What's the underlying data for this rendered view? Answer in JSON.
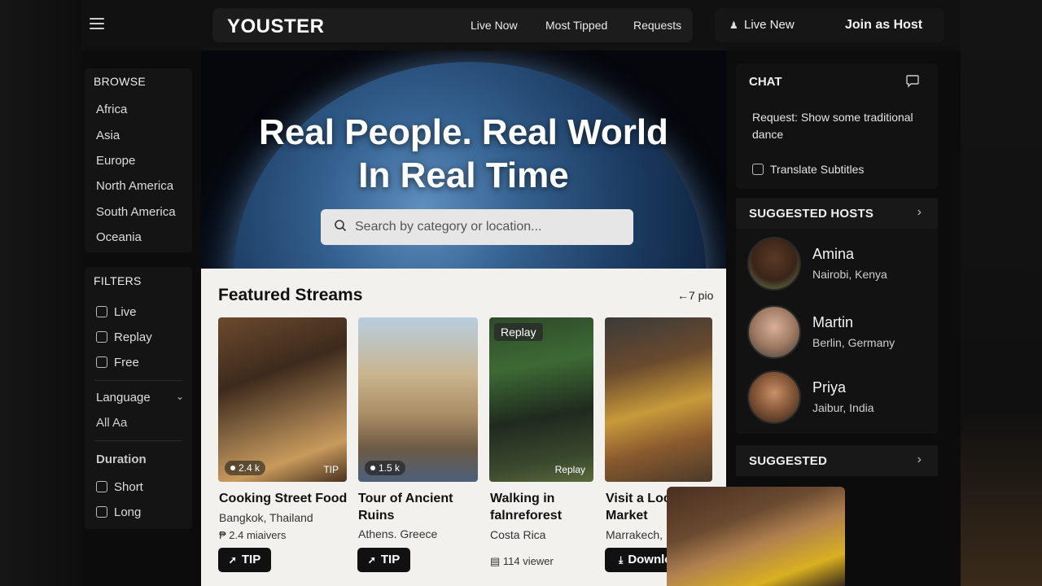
{
  "header": {
    "brand": "YOUSTER",
    "nav": [
      "Live Now",
      "Most Tipped",
      "Requests"
    ],
    "live_new": "Live New",
    "join_host": "Join as Host"
  },
  "browse": {
    "title": "BROWSE",
    "regions": [
      "Africa",
      "Asia",
      "Europe",
      "North America",
      "South America",
      "Oceania"
    ]
  },
  "filters": {
    "title": "FILTERS",
    "types": [
      "Live",
      "Replay",
      "Free"
    ],
    "language_label": "Language",
    "language_value": "All  Aa",
    "duration_title": "Duration",
    "durations": [
      "Short",
      "Long"
    ]
  },
  "hero": {
    "title_line1": "Real People. Real World",
    "title_line2": "In Real Time",
    "search_placeholder": "Search by category or location..."
  },
  "featured": {
    "title": "Featured Streams",
    "more": "←7 pio",
    "cards": [
      {
        "title": "Cooking Street Food",
        "location": "Bangkok, Thailand",
        "meta": "₱ 2.4 miaivers",
        "viewers": "2.4 k",
        "tag": "TIP",
        "button": "TIP"
      },
      {
        "title": "Tour of Ancient Ruins",
        "location": "Athens. Greece",
        "viewers": "1.5 k",
        "button": "TIP"
      },
      {
        "title": "Walking in falnreforest",
        "location": "Costa Rica",
        "meta": "114 viewer",
        "badge_top": "Replay",
        "badge_bottom": "Replay"
      },
      {
        "title": "Visit a Local Market",
        "location": "Marrakech, Moroco",
        "button": "Download"
      }
    ]
  },
  "chat": {
    "title": "CHAT",
    "message": "Request: Show some traditional dance",
    "translate": "Translate Subtitles"
  },
  "suggested_hosts": {
    "title": "SUGGESTED HOSTS",
    "hosts": [
      {
        "name": "Amina",
        "location": "Nairobi, Kenya"
      },
      {
        "name": "Martin",
        "location": "Berlin, Germany"
      },
      {
        "name": "Priya",
        "location": "Jaibur, India"
      }
    ]
  },
  "suggested": {
    "title": "SUGGESTED"
  },
  "colors": {
    "accent_dark": "#111111",
    "panel": "#141414",
    "featured_bg": "#f3f1ee"
  }
}
